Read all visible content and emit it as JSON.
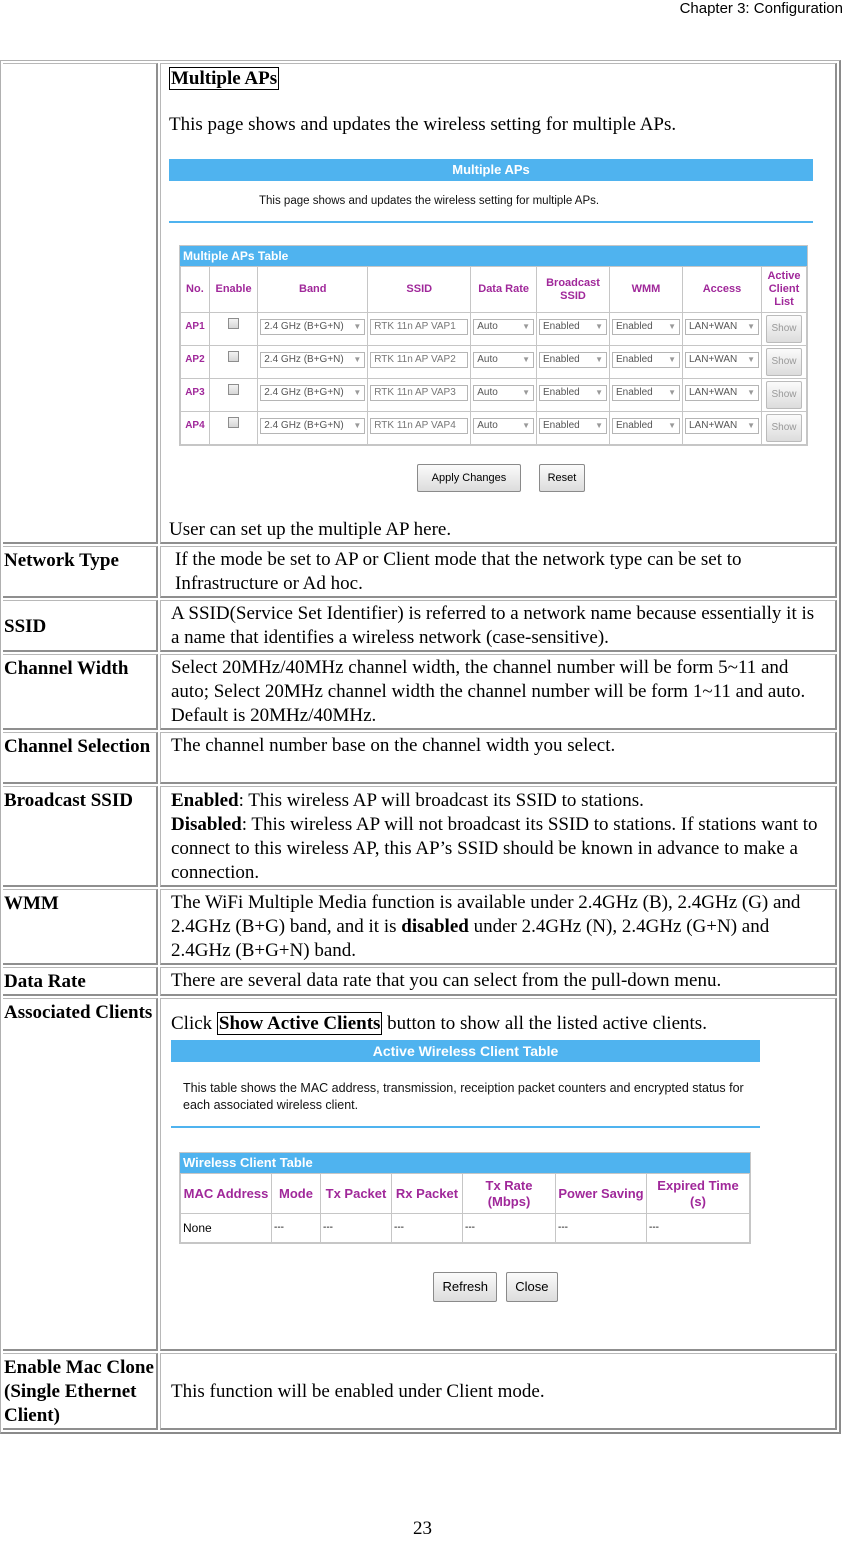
{
  "header": {
    "chapter": "Chapter 3: Configuration"
  },
  "footer": {
    "page_number": "23"
  },
  "rows": [
    {
      "label": "",
      "section_title": "Multiple APs",
      "intro": "This page shows and updates the wireless setting for multiple APs.",
      "caption": "User can set up the multiple AP here."
    },
    {
      "label": "Network Type",
      "text": "If the mode be set to AP or Client mode that the network type can be set to Infrastructure or Ad hoc."
    },
    {
      "label": "SSID",
      "text": "A SSID(Service Set Identifier) is referred to a network name because essentially it is a name that identifies a wireless network (case-sensitive)."
    },
    {
      "label": "Channel Width",
      "text": "Select 20MHz/40MHz channel width, the channel number will be form 5~11 and auto; Select 20MHz channel width the channel number will be form 1~11 and auto. Default is 20MHz/40MHz."
    },
    {
      "label": "Channel Selection",
      "text": "The channel number base on the channel width you select."
    },
    {
      "label": "Broadcast SSID",
      "enabled_term": "Enabled",
      "enabled_text": ": This wireless AP will broadcast its SSID to stations.",
      "disabled_term": "Disabled",
      "disabled_text": ": This wireless AP will not broadcast its SSID to stations. If stations want to connect to this wireless AP, this AP’s SSID should be known in advance to make a connection."
    },
    {
      "label": "WMM",
      "text_before": "The WiFi Multiple Media function is available under 2.4GHz (B), 2.4GHz (G) and 2.4GHz (B+G) band, and it is ",
      "text_bold": "disabled",
      "text_after": " under 2.4GHz (N), 2.4GHz (G+N) and 2.4GHz (B+G+N) band."
    },
    {
      "label": "Data Rate",
      "text": "There are several data rate that you can select from the pull-down menu."
    },
    {
      "label": "Associated Clients",
      "text_before": "Click ",
      "button_ref": "Show Active Clients",
      "text_after": " button to show all the listed active clients."
    },
    {
      "label": "Enable Mac Clone (Single Ethernet Client)",
      "text": "This function will be enabled under Client mode."
    }
  ],
  "multiple_aps_ui": {
    "banner": "Multiple APs",
    "subtitle": "This page shows and updates the wireless setting for multiple APs.",
    "table_title": "Multiple APs Table",
    "columns": [
      "No.",
      "Enable",
      "Band",
      "SSID",
      "Data Rate",
      "Broadcast SSID",
      "WMM",
      "Access",
      "Active Client List"
    ],
    "aps": [
      {
        "no": "AP1",
        "enabled": false,
        "band": "2.4 GHz (B+G+N)",
        "ssid": "RTK 11n AP VAP1",
        "data_rate": "Auto",
        "broadcast": "Enabled",
        "wmm": "Enabled",
        "access": "LAN+WAN",
        "show": "Show"
      },
      {
        "no": "AP2",
        "enabled": false,
        "band": "2.4 GHz (B+G+N)",
        "ssid": "RTK 11n AP VAP2",
        "data_rate": "Auto",
        "broadcast": "Enabled",
        "wmm": "Enabled",
        "access": "LAN+WAN",
        "show": "Show"
      },
      {
        "no": "AP3",
        "enabled": false,
        "band": "2.4 GHz (B+G+N)",
        "ssid": "RTK 11n AP VAP3",
        "data_rate": "Auto",
        "broadcast": "Enabled",
        "wmm": "Enabled",
        "access": "LAN+WAN",
        "show": "Show"
      },
      {
        "no": "AP4",
        "enabled": false,
        "band": "2.4 GHz (B+G+N)",
        "ssid": "RTK 11n AP VAP4",
        "data_rate": "Auto",
        "broadcast": "Enabled",
        "wmm": "Enabled",
        "access": "LAN+WAN",
        "show": "Show"
      }
    ],
    "apply_label": "Apply Changes",
    "reset_label": "Reset"
  },
  "active_clients_ui": {
    "banner": "Active Wireless Client Table",
    "subtitle": "This table shows the MAC address, transmission, receiption packet counters and encrypted status for each associated wireless client.",
    "table_title": "Wireless Client Table",
    "columns": [
      "MAC Address",
      "Mode",
      "Tx Packet",
      "Rx Packet",
      "Tx Rate (Mbps)",
      "Power Saving",
      "Expired Time (s)"
    ],
    "rows": [
      [
        "None",
        "---",
        "---",
        "---",
        "---",
        "---",
        "---"
      ]
    ],
    "refresh_label": "Refresh",
    "close_label": "Close"
  }
}
